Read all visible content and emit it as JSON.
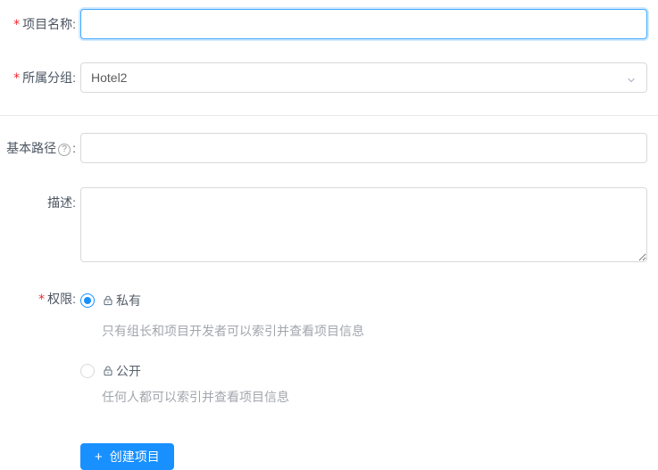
{
  "colors": {
    "accent": "#1890ff",
    "input_border": "#d9d9d9",
    "focus_border": "#40a9ff",
    "divider": "#e9e9e9",
    "required_mark": "#f5222d",
    "muted_text": "#a2a6ad"
  },
  "form": {
    "project_name": {
      "required_mark": "*",
      "label": "项目名称",
      "colon": ":",
      "value": "",
      "focused": true
    },
    "group": {
      "required_mark": "*",
      "label": "所属分组",
      "colon": ":",
      "value": "Hotel2"
    },
    "base_path": {
      "label": "基本路径",
      "help": "?",
      "colon": ":",
      "value": ""
    },
    "description": {
      "label": "描述",
      "colon": ":",
      "value": ""
    },
    "permission": {
      "required_mark": "*",
      "label": "权限",
      "colon": ":",
      "options": [
        {
          "label": "私有",
          "icon": "lock-closed-icon",
          "selected": true,
          "description": "只有组长和项目开发者可以索引并查看项目信息"
        },
        {
          "label": "公开",
          "icon": "lock-open-icon",
          "selected": false,
          "description": "任何人都可以索引并查看项目信息"
        }
      ]
    },
    "submit_button": {
      "icon": "+",
      "label": "创建项目"
    }
  }
}
